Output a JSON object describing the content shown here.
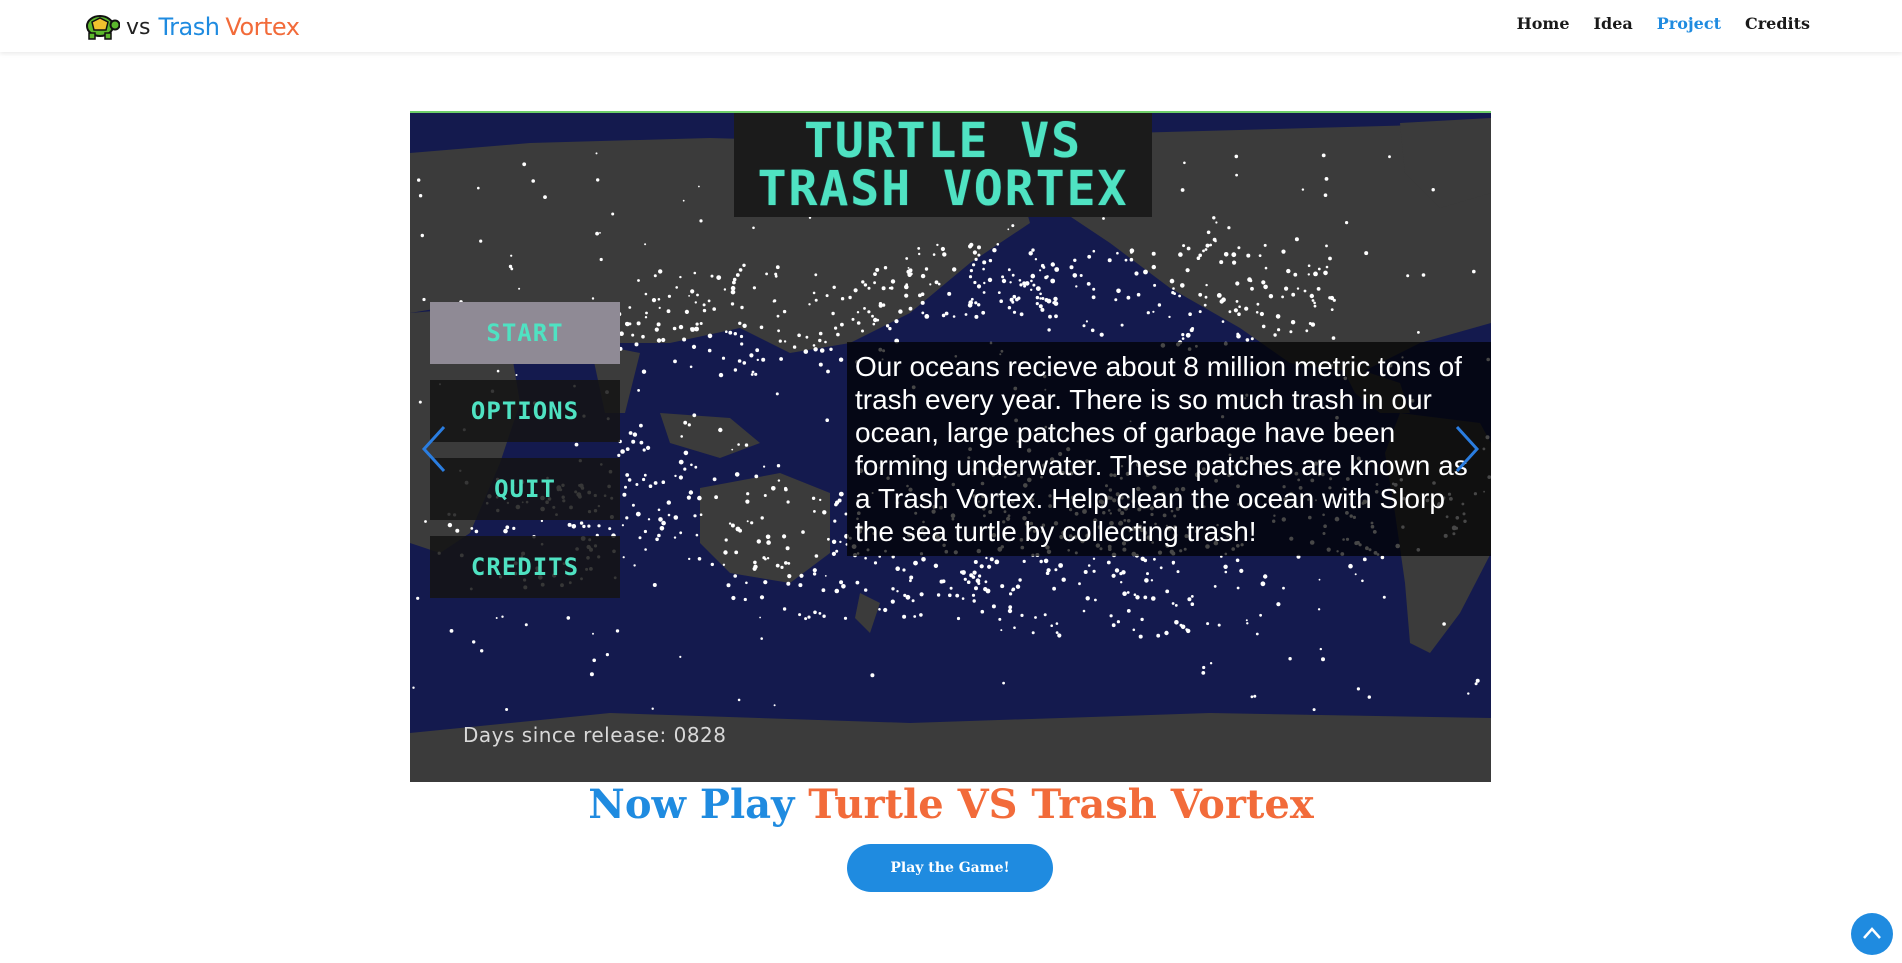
{
  "header": {
    "logo": {
      "vs": "vs",
      "trash": "Trash",
      "vortex": "Vortex"
    },
    "nav": [
      {
        "label": "Home",
        "active": false
      },
      {
        "label": "Idea",
        "active": false
      },
      {
        "label": "Project",
        "active": true
      },
      {
        "label": "Credits",
        "active": false
      }
    ]
  },
  "carousel": {
    "title_line1": "TURTLE VS",
    "title_line2": "TRASH VORTEX",
    "menu": [
      "START",
      "OPTIONS",
      "QUIT",
      "CREDITS"
    ],
    "selected_menu": "START",
    "caption": "Our oceans recieve about 8 million metric tons of trash every year. There is so much trash in our ocean, large patches of garbage have been forming underwater. These patches are known as a Trash Vortex. Help clean the ocean with Slorp the sea turtle by collecting trash!",
    "days_label": "Days since release: 0828",
    "prev_icon": "chevron-left-icon",
    "next_icon": "chevron-right-icon"
  },
  "headline": {
    "part1": "Now Play",
    "part2": "Turtle VS Trash Vortex"
  },
  "cta": {
    "label": "Play the Game!"
  },
  "back_to_top_icon": "chevron-up-icon",
  "colors": {
    "accent_blue": "#1f8be0",
    "accent_orange": "#f26b3a",
    "title_teal": "#4fe2c2",
    "ocean": "#141a4e"
  }
}
